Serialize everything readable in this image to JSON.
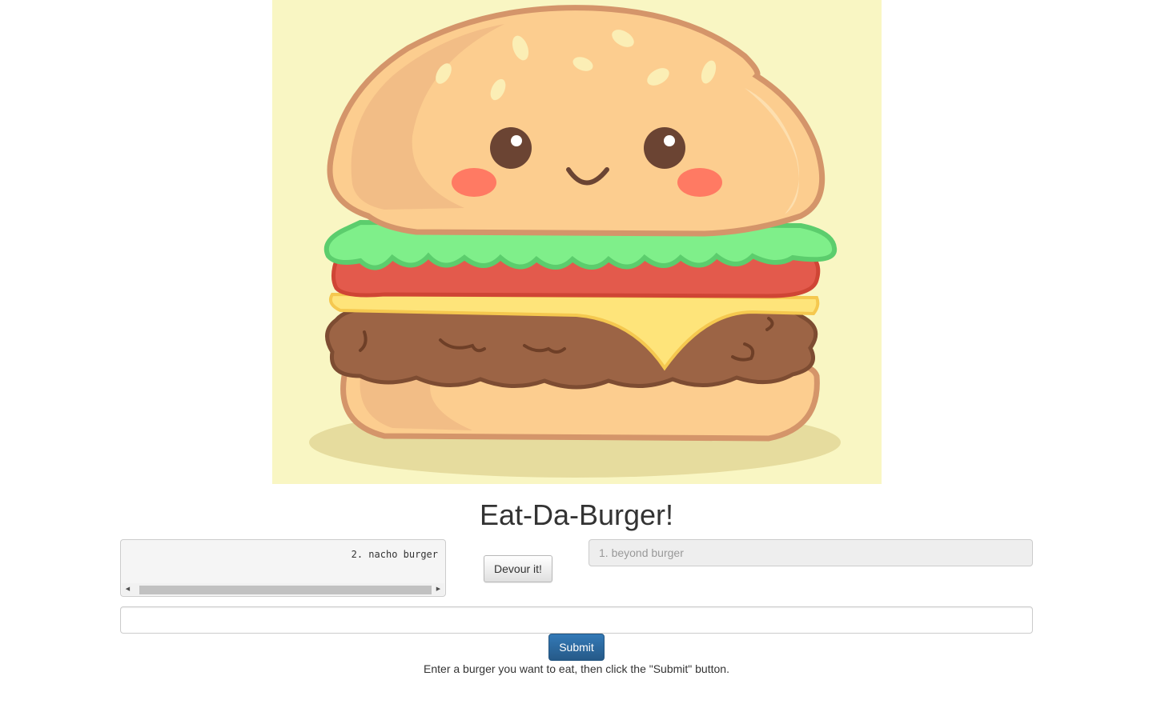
{
  "hero": {
    "image_name": "cute-burger-illustration",
    "background_color": "#f9f6c3"
  },
  "page_title": "Eat-Da-Burger!",
  "devoured": {
    "items": [
      "2. nacho burger"
    ]
  },
  "devour_button": {
    "label": "Devour it!"
  },
  "burger_select": {
    "selected": "1. beyond burger"
  },
  "burger_input": {
    "value": "",
    "placeholder": ""
  },
  "submit_button": {
    "label": "Submit",
    "color": "#337ab7"
  },
  "helper_text": "Enter a burger you want to eat, then click the \"Submit\" button."
}
